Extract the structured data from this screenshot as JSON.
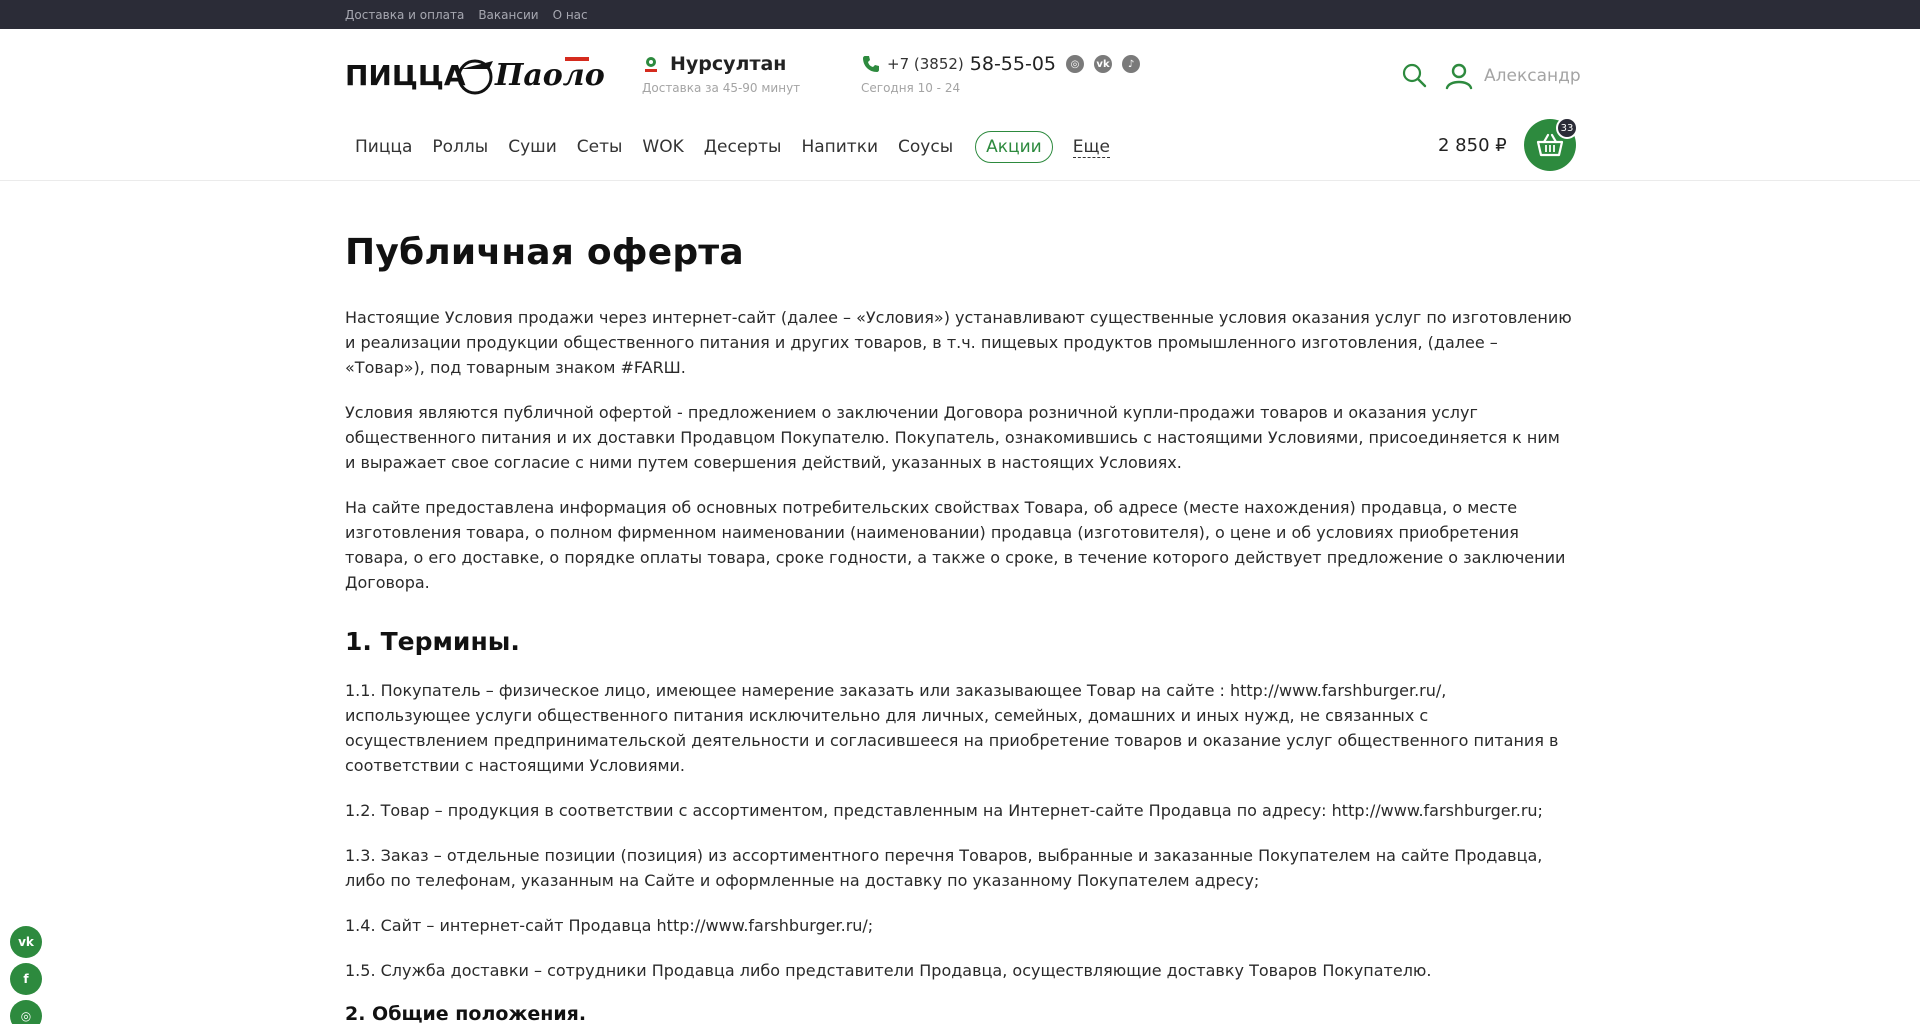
{
  "topbar": {
    "links": [
      "Доставка и оплата",
      "Вакансии",
      "О нас"
    ]
  },
  "header": {
    "logo_text": "ПИЦЦА Паоло",
    "city": "Нурсултан",
    "delivery_time": "Доставка за 45-90 минут",
    "phone_prefix": "+7 (3852)",
    "phone_main": "58-55-05",
    "hours": "Сегодня 10 - 24",
    "user_name": "Александр",
    "social_icons": [
      "instagram-icon",
      "vk-icon",
      "tiktok-icon"
    ]
  },
  "nav": {
    "items": [
      "Пицца",
      "Роллы",
      "Суши",
      "Сеты",
      "WOK",
      "Десерты",
      "Напитки",
      "Соусы"
    ],
    "promo": "Акции",
    "more": "Еще"
  },
  "cart": {
    "total": "2 850 ₽",
    "count": "33"
  },
  "content": {
    "title": "Публичная оферта",
    "intro": [
      "Настоящие Условия продажи через интернет-сайт (далее – «Условия») устанавливают существенные условия оказания услуг по изготовлению и реализации продукции общественного питания и других товаров, в т.ч. пищевых продуктов промышленного изготовления, (далее – «Товар»), под товарным знаком #FARШ.",
      "Условия являются публичной офертой - предложением о заключении Договора розничной купли-продажи товаров и оказания услуг общественного питания и их доставки Продавцом Покупателю. Покупатель, ознакомившись с настоящими Условиями, присоединяется к ним и выражает свое согласие с ними путем совершения действий, указанных в настоящих Условиях.",
      "На сайте предоставлена информация об основных потребительских свойствах Товара, об адресе (месте нахождения) продавца, о месте изготовления товара, о полном фирменном наименовании (наименовании) продавца (изготовителя), о цене и об условиях приобретения товара, о его доставке, о порядке оплаты товара, сроке годности, а также о сроке, в течение которого действует предложение о заключении Договора."
    ],
    "section1_title": "1. Термины.",
    "section1": [
      "1.1. Покупатель – физическое лицо, имеющее намерение заказать или заказывающее Товар на сайте : http://www.farshburger.ru/, использующее услуги общественного питания исключительно для личных, семейных, домашних и иных нужд, не связанных с осуществлением предпринимательской деятельности и согласившееся на приобретение товаров и оказание услуг общественного питания в соответствии с настоящими Условиями.",
      "1.2. Товар – продукция в соответствии с ассортиментом, представленным на Интернет-сайте Продавца по адресу: http://www.farshburger.ru;",
      "1.3. Заказ – отдельные позиции (позиция) из ассортиментного перечня Товаров, выбранные и заказанные Покупателем на сайте Продавца, либо по телефонам, указанным на Сайте и оформленные на доставку по указанному Покупателем адресу;",
      "1.4. Сайт – интернет-сайт Продавца http://www.farshburger.ru/;",
      "1.5. Служба доставки – сотрудники Продавца либо представители Продавца, осуществляющие доставку Товаров Покупателю."
    ],
    "section2_title": "2. Общие положения."
  },
  "float_social": [
    "vk-icon",
    "facebook-icon",
    "instagram-icon"
  ],
  "colors": {
    "accent": "#2d8a3e",
    "topbar": "#2b2c37"
  }
}
